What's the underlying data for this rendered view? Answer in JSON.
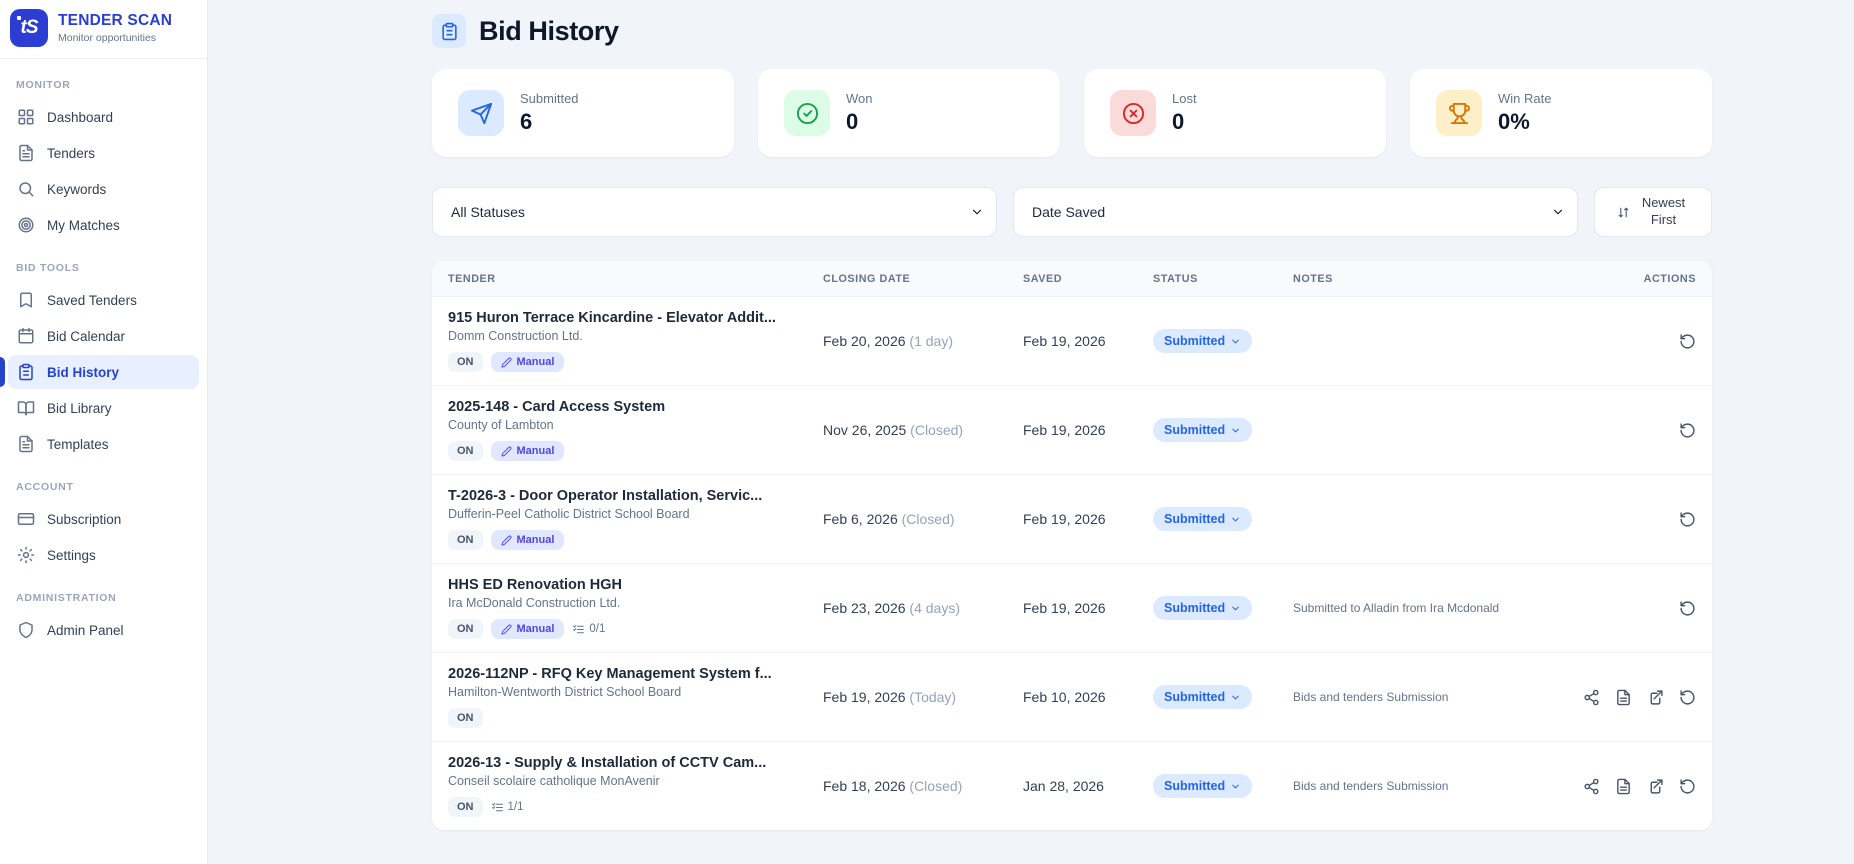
{
  "brand": {
    "name": "TENDER SCAN",
    "tagline": "Monitor opportunities",
    "color": "#2b3dd2"
  },
  "sidebar": {
    "sections": [
      {
        "label": "MONITOR",
        "items": [
          {
            "label": "Dashboard",
            "icon": "dashboard-icon"
          },
          {
            "label": "Tenders",
            "icon": "document-icon"
          },
          {
            "label": "Keywords",
            "icon": "search-icon"
          },
          {
            "label": "My Matches",
            "icon": "target-icon"
          }
        ]
      },
      {
        "label": "BID TOOLS",
        "items": [
          {
            "label": "Saved Tenders",
            "icon": "bookmark-icon"
          },
          {
            "label": "Bid Calendar",
            "icon": "calendar-icon"
          },
          {
            "label": "Bid History",
            "icon": "clipboard-icon",
            "active": true
          },
          {
            "label": "Bid Library",
            "icon": "book-icon"
          },
          {
            "label": "Templates",
            "icon": "document-icon"
          }
        ]
      },
      {
        "label": "ACCOUNT",
        "items": [
          {
            "label": "Subscription",
            "icon": "credit-card-icon"
          },
          {
            "label": "Settings",
            "icon": "gear-icon"
          }
        ]
      },
      {
        "label": "ADMINISTRATION",
        "items": [
          {
            "label": "Admin Panel",
            "icon": "shield-icon"
          }
        ]
      }
    ]
  },
  "header": {
    "title": "Bid History",
    "icon": "clipboard-icon"
  },
  "stats": [
    {
      "label": "Submitted",
      "value": "6",
      "icon": "send-icon",
      "color": "#2563eb",
      "bg": "#dbeafe"
    },
    {
      "label": "Won",
      "value": "0",
      "icon": "check-circle-icon",
      "color": "#16a34a",
      "bg": "#dcfce7"
    },
    {
      "label": "Lost",
      "value": "0",
      "icon": "x-circle-icon",
      "color": "#dc2626",
      "bg": "#fbdada"
    },
    {
      "label": "Win Rate",
      "value": "0%",
      "icon": "trophy-icon",
      "color": "#d97706",
      "bg": "#fdf0c9"
    }
  ],
  "filters": {
    "status_select": "All Statuses",
    "date_select": "Date Saved",
    "sort_button": "Newest First"
  },
  "table": {
    "headers": [
      "TENDER",
      "CLOSING DATE",
      "SAVED",
      "STATUS",
      "NOTES",
      "ACTIONS"
    ],
    "rows": [
      {
        "title": "915 Huron Terrace Kincardine - Elevator Addit...",
        "org": "Domm Construction Ltd.",
        "badges": [
          {
            "type": "on",
            "label": "ON"
          },
          {
            "type": "manual",
            "label": "Manual"
          }
        ],
        "closing_date": "Feb 20, 2026",
        "closing_note": "(1 day)",
        "saved": "Feb 19, 2026",
        "status": "Submitted",
        "notes": "",
        "actions": [
          "rotate-ccw-icon"
        ]
      },
      {
        "title": "2025-148 - Card Access System",
        "org": "County of Lambton",
        "badges": [
          {
            "type": "on",
            "label": "ON"
          },
          {
            "type": "manual",
            "label": "Manual"
          }
        ],
        "closing_date": "Nov 26, 2025",
        "closing_note": "(Closed)",
        "saved": "Feb 19, 2026",
        "status": "Submitted",
        "notes": "",
        "actions": [
          "rotate-ccw-icon"
        ]
      },
      {
        "title": "T-2026-3 - Door Operator Installation, Servic...",
        "org": "Dufferin-Peel Catholic District School Board",
        "badges": [
          {
            "type": "on",
            "label": "ON"
          },
          {
            "type": "manual",
            "label": "Manual"
          }
        ],
        "closing_date": "Feb 6, 2026",
        "closing_note": "(Closed)",
        "saved": "Feb 19, 2026",
        "status": "Submitted",
        "notes": "",
        "actions": [
          "rotate-ccw-icon"
        ]
      },
      {
        "title": "HHS ED Renovation HGH",
        "org": "Ira McDonald Construction Ltd.",
        "badges": [
          {
            "type": "on",
            "label": "ON"
          },
          {
            "type": "manual",
            "label": "Manual"
          },
          {
            "type": "checklist",
            "label": "0/1"
          }
        ],
        "closing_date": "Feb 23, 2026",
        "closing_note": "(4 days)",
        "saved": "Feb 19, 2026",
        "status": "Submitted",
        "notes": "Submitted to Alladin from Ira Mcdonald",
        "actions": [
          "rotate-ccw-icon"
        ]
      },
      {
        "title": "2026-112NP - RFQ Key Management System f...",
        "org": "Hamilton-Wentworth District School Board",
        "badges": [
          {
            "type": "on",
            "label": "ON"
          }
        ],
        "closing_date": "Feb 19, 2026",
        "closing_note": "(Today)",
        "saved": "Feb 10, 2026",
        "status": "Submitted",
        "notes": "Bids and tenders Submission",
        "actions": [
          "share-icon",
          "file-text-icon",
          "external-link-icon",
          "rotate-ccw-icon"
        ]
      },
      {
        "title": "2026-13 - Supply & Installation of CCTV Cam...",
        "org": "Conseil scolaire catholique MonAvenir",
        "badges": [
          {
            "type": "on",
            "label": "ON"
          },
          {
            "type": "checklist",
            "label": "1/1"
          }
        ],
        "closing_date": "Feb 18, 2026",
        "closing_note": "(Closed)",
        "saved": "Jan 28, 2026",
        "status": "Submitted",
        "notes": "Bids and tenders Submission",
        "actions": [
          "share-icon",
          "file-text-icon",
          "external-link-icon",
          "rotate-ccw-icon"
        ]
      }
    ]
  }
}
